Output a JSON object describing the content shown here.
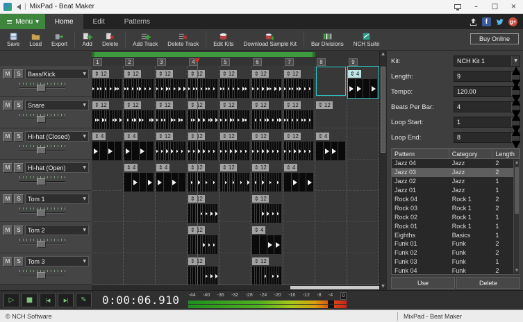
{
  "window": {
    "title": "MixPad - Beat Maker"
  },
  "menubar": {
    "menu_button": "Menu",
    "tabs": [
      {
        "label": "Home",
        "active": true
      },
      {
        "label": "Edit"
      },
      {
        "label": "Patterns"
      }
    ]
  },
  "toolbar": {
    "groups": [
      [
        "Save",
        "Load",
        "Export"
      ],
      [
        "Add",
        "Delete"
      ],
      [
        "Add Track",
        "Delete Track"
      ],
      [
        "Edit Kits",
        "Download Sample Kit"
      ],
      [
        "Bar Divisions",
        "NCH Suite"
      ]
    ],
    "buy_online": "Buy Online"
  },
  "track_buttons": {
    "mute": "M",
    "solo": "S"
  },
  "tracks": [
    {
      "name": "Bass/Kick"
    },
    {
      "name": "Snare"
    },
    {
      "name": "Hi-hat (Closed)"
    },
    {
      "name": "Hi-hat (Open)"
    },
    {
      "name": "Tom 1"
    },
    {
      "name": "Tom 2"
    },
    {
      "name": "Tom 3"
    }
  ],
  "grid": {
    "bar_numbers": [
      "1",
      "2",
      "3",
      "4",
      "5",
      "6",
      "7",
      "8",
      "9"
    ],
    "playhead_fraction": 0.368,
    "loop_start_bar": 1,
    "loop_end_bar": 8,
    "selection": {
      "track": 0,
      "bar": 8
    },
    "segments": [
      {
        "track": 0,
        "bar": 1,
        "div": 12,
        "hits": [
          0,
          2,
          3,
          5,
          7,
          9,
          10
        ]
      },
      {
        "track": 0,
        "bar": 2,
        "div": 12,
        "hits": [
          0,
          1,
          3,
          5,
          6,
          8,
          10
        ]
      },
      {
        "track": 0,
        "bar": 3,
        "div": 12,
        "hits": [
          0,
          2,
          4,
          5,
          7,
          9,
          11
        ]
      },
      {
        "track": 0,
        "bar": 4,
        "div": 12,
        "hits": [
          0,
          2,
          3,
          5,
          7,
          8,
          10
        ]
      },
      {
        "track": 0,
        "bar": 5,
        "div": 12,
        "hits": [
          0,
          1,
          3,
          5,
          7,
          9,
          10
        ]
      },
      {
        "track": 0,
        "bar": 6,
        "div": 12,
        "hits": [
          0,
          2,
          4,
          6,
          7,
          9,
          11
        ]
      },
      {
        "track": 0,
        "bar": 7,
        "div": 12,
        "hits": [
          0,
          2,
          3,
          5,
          6,
          8,
          10
        ]
      },
      {
        "track": 0,
        "bar": 9,
        "div": 4,
        "hits": [
          0,
          1,
          3
        ],
        "selected": true
      },
      {
        "track": 1,
        "bar": 1,
        "div": 12,
        "hits": [
          1,
          2,
          4,
          5,
          8,
          9,
          11
        ]
      },
      {
        "track": 1,
        "bar": 2,
        "div": 12,
        "hits": [
          1,
          3,
          4,
          6,
          7,
          10,
          11
        ]
      },
      {
        "track": 1,
        "bar": 3,
        "div": 12,
        "hits": [
          0,
          2,
          3,
          6,
          7,
          9,
          10
        ]
      },
      {
        "track": 1,
        "bar": 4,
        "div": 12,
        "hits": [
          1,
          2,
          4,
          6,
          8,
          9,
          11
        ]
      },
      {
        "track": 1,
        "bar": 5,
        "div": 12,
        "hits": [
          0,
          2,
          4,
          5,
          7,
          9,
          10
        ]
      },
      {
        "track": 1,
        "bar": 6,
        "div": 12,
        "hits": [
          1,
          3,
          5,
          6,
          8,
          10,
          11
        ]
      },
      {
        "track": 1,
        "bar": 7,
        "div": 12,
        "hits": [
          0,
          1,
          3,
          5,
          7,
          8,
          10
        ]
      },
      {
        "track": 1,
        "bar": 8,
        "div": 12,
        "hits": [],
        "headerOnly": true
      },
      {
        "track": 2,
        "bar": 1,
        "div": 4,
        "hits": [
          0,
          2
        ]
      },
      {
        "track": 2,
        "bar": 2,
        "div": 4,
        "hits": [
          0,
          2
        ]
      },
      {
        "track": 2,
        "bar": 3,
        "div": 12,
        "hits": [
          0,
          2,
          4,
          6,
          8,
          10
        ]
      },
      {
        "track": 2,
        "bar": 4,
        "div": 12,
        "hits": [
          0,
          2,
          4,
          6,
          8,
          10
        ]
      },
      {
        "track": 2,
        "bar": 5,
        "div": 12,
        "hits": [
          0,
          2,
          4,
          6,
          8,
          10
        ]
      },
      {
        "track": 2,
        "bar": 6,
        "div": 12,
        "hits": [
          0,
          2,
          4,
          6,
          8,
          10
        ]
      },
      {
        "track": 2,
        "bar": 7,
        "div": 12,
        "hits": [
          0,
          2,
          4,
          6,
          8,
          10
        ]
      },
      {
        "track": 2,
        "bar": 8,
        "div": 4,
        "hits": [
          1,
          2
        ]
      },
      {
        "track": 3,
        "bar": 2,
        "div": 4,
        "hits": [
          1,
          3
        ]
      },
      {
        "track": 3,
        "bar": 3,
        "div": 4,
        "hits": [
          0,
          2
        ]
      },
      {
        "track": 3,
        "bar": 4,
        "div": 12,
        "hits": [
          1,
          4,
          7,
          10
        ]
      },
      {
        "track": 3,
        "bar": 5,
        "div": 12,
        "hits": [
          2,
          5,
          8,
          11
        ]
      },
      {
        "track": 3,
        "bar": 6,
        "div": 12,
        "hits": [
          1,
          4,
          7,
          10
        ]
      },
      {
        "track": 3,
        "bar": 7,
        "div": 4,
        "hits": [
          1,
          3
        ]
      },
      {
        "track": 4,
        "bar": 4,
        "div": 12,
        "hits": [
          5,
          7,
          9,
          11
        ]
      },
      {
        "track": 4,
        "bar": 6,
        "div": 12,
        "hits": [
          4,
          6,
          8,
          10
        ]
      },
      {
        "track": 5,
        "bar": 4,
        "div": 12,
        "hits": [
          6,
          8,
          10
        ]
      },
      {
        "track": 5,
        "bar": 6,
        "div": 4,
        "hits": [
          2,
          3
        ]
      },
      {
        "track": 6,
        "bar": 4,
        "div": 12,
        "hits": [
          7,
          9,
          11
        ]
      },
      {
        "track": 6,
        "bar": 6,
        "div": 12,
        "hits": [
          5,
          8,
          10
        ]
      }
    ]
  },
  "right_panel": {
    "fields": [
      {
        "label": "Kit:",
        "value": "NCH Kit 1",
        "type": "select"
      },
      {
        "label": "Length:",
        "value": "9",
        "type": "spin"
      },
      {
        "label": "Tempo:",
        "value": "120.00",
        "type": "spin"
      },
      {
        "label": "Beats Per Bar:",
        "value": "4",
        "type": "spin"
      },
      {
        "label": "Loop Start:",
        "value": "1",
        "type": "spin"
      },
      {
        "label": "Loop End:",
        "value": "8",
        "type": "spin"
      }
    ],
    "pattern_table": {
      "headers": [
        "Pattern",
        "Category",
        "Length"
      ],
      "rows": [
        [
          "Jazz 04",
          "Jazz",
          "2"
        ],
        [
          "Jazz 03",
          "Jazz",
          "2"
        ],
        [
          "Jazz 02",
          "Jazz",
          "1"
        ],
        [
          "Jazz 01",
          "Jazz",
          "1"
        ],
        [
          "Rock 04",
          "Rock 1",
          "2"
        ],
        [
          "Rock 03",
          "Rock 1",
          "2"
        ],
        [
          "Rock 02",
          "Rock 1",
          "1"
        ],
        [
          "Rock 01",
          "Rock 1",
          "1"
        ],
        [
          "Eighths",
          "Basics",
          "1"
        ],
        [
          "Funk 01",
          "Funk",
          "2"
        ],
        [
          "Funk 02",
          "Funk",
          "2"
        ],
        [
          "Funk 03",
          "Funk",
          "1"
        ],
        [
          "Funk 04",
          "Funk",
          "2"
        ]
      ],
      "selected_row": 1
    },
    "use_button": "Use",
    "delete_button": "Delete"
  },
  "transport": {
    "time": "0:00:06.910",
    "meter_labels": [
      "-44",
      "-40",
      "-36",
      "-32",
      "-28",
      "-24",
      "-20",
      "-16",
      "-12",
      "-8",
      "-4",
      "0"
    ]
  },
  "statusbar": {
    "copyright": "© NCH Software",
    "app_name": "MixPad - Beat Maker"
  },
  "icons": {
    "hamburger": "≡",
    "caret": "▼",
    "minimize": "–",
    "maximize": "□",
    "close": "×",
    "division": "⇕",
    "spin_up": "▲",
    "spin_down": "▼",
    "scroll_up": "▲",
    "scroll_down": "▼",
    "play": "▷",
    "stop": "■",
    "go_start": "|◀",
    "go_end": "▶|",
    "pencil": "✎",
    "facebook": "f",
    "gplus": "g+"
  },
  "colors": {
    "accent_green": "#3e853e",
    "loop_green": "#3f9b3f",
    "selection_cyan": "#2cc8c8",
    "playhead_red": "#d03030",
    "facebook_blue": "#3b5998",
    "twitter_blue": "#5bb8e8"
  }
}
